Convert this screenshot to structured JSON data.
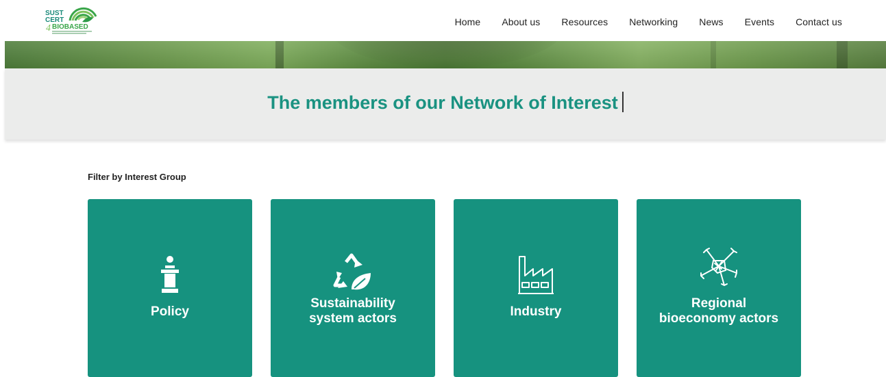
{
  "logo": {
    "line1": "SUST",
    "line2": "CERT",
    "line3": "BIOBASED",
    "digit": "4"
  },
  "nav": {
    "items": [
      "Home",
      "About us",
      "Resources",
      "Networking",
      "News",
      "Events",
      "Contact us"
    ]
  },
  "page": {
    "title": "The members of our Network of Interest"
  },
  "filter": {
    "label": "Filter by Interest Group"
  },
  "cards": [
    {
      "line1": "Policy",
      "line2": "",
      "icon": "podium-speaker-icon"
    },
    {
      "line1": "Sustainability",
      "line2": "system actors",
      "icon": "recycle-leaf-icon"
    },
    {
      "line1": "Industry",
      "line2": "",
      "icon": "factory-icon"
    },
    {
      "line1": "Regional",
      "line2": "bioeconomy actors",
      "icon": "joined-hands-icon"
    }
  ],
  "colors": {
    "accent": "#16927f",
    "title": "#1a9281",
    "band": "#ebeceb",
    "logo_green": "#3aa64a",
    "logo_teal": "#1a8a7a"
  }
}
